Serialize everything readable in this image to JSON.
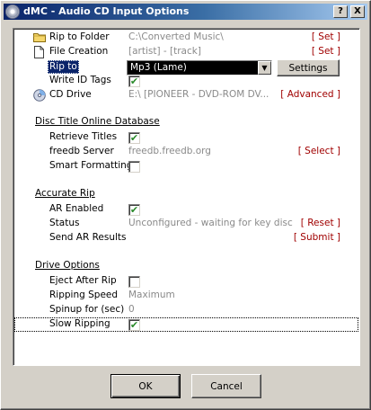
{
  "window": {
    "title": "dMC - Audio CD Input Options",
    "help_glyph": "?",
    "close_glyph": "X"
  },
  "rows": {
    "rip_to_folder": {
      "label": "Rip to Folder",
      "value": "C:\\Converted Music\\",
      "action": "[ Set ]"
    },
    "file_creation": {
      "label": "File Creation",
      "value": "[artist] - [track]",
      "action": "[ Set ]"
    },
    "rip_to": {
      "label": "Rip to",
      "selected": "Mp3 (Lame)",
      "settings_label": "Settings"
    },
    "write_id_tags": {
      "label": "Write ID Tags",
      "checked": true
    },
    "cd_drive": {
      "label": "CD Drive",
      "value": "E:\\   [PIONEER  - DVD-ROM DV...",
      "action": "[ Advanced ]"
    }
  },
  "sections": {
    "disc_title": {
      "header": "Disc Title Online Database",
      "retrieve_titles": {
        "label": "Retrieve Titles",
        "checked": true
      },
      "freedb_server": {
        "label": "freedb Server",
        "value": "freedb.freedb.org",
        "action": "[ Select ]"
      },
      "smart_formatting": {
        "label": "Smart Formatting",
        "checked": false
      }
    },
    "accurate_rip": {
      "header": "Accurate Rip",
      "ar_enabled": {
        "label": "AR Enabled",
        "checked": true
      },
      "status": {
        "label": "Status",
        "value": "Unconfigured - waiting for key disc",
        "action": "[ Reset ]"
      },
      "send_ar_results": {
        "label": "Send AR Results",
        "action": "[ Submit ]"
      }
    },
    "drive_options": {
      "header": "Drive Options",
      "eject_after_rip": {
        "label": "Eject After Rip",
        "checked": false
      },
      "ripping_speed": {
        "label": "Ripping Speed",
        "value": "Maximum"
      },
      "spinup": {
        "label": "Spinup for (sec)",
        "value": "0"
      },
      "slow_ripping": {
        "label": "Slow Ripping",
        "checked": true
      }
    }
  },
  "buttons": {
    "ok": "OK",
    "cancel": "Cancel"
  },
  "glyphs": {
    "check": "✔",
    "combo_arrow": "▼"
  },
  "colors": {
    "title_start": "#0a246a",
    "title_end": "#a6caf0",
    "link": "#a00000",
    "muted": "#8a8a8a",
    "check": "#2a8a2a"
  },
  "icons": {
    "folder": "folder-icon",
    "file": "file-icon",
    "cd": "cd-drive-icon",
    "app": "app-cd-icon"
  }
}
